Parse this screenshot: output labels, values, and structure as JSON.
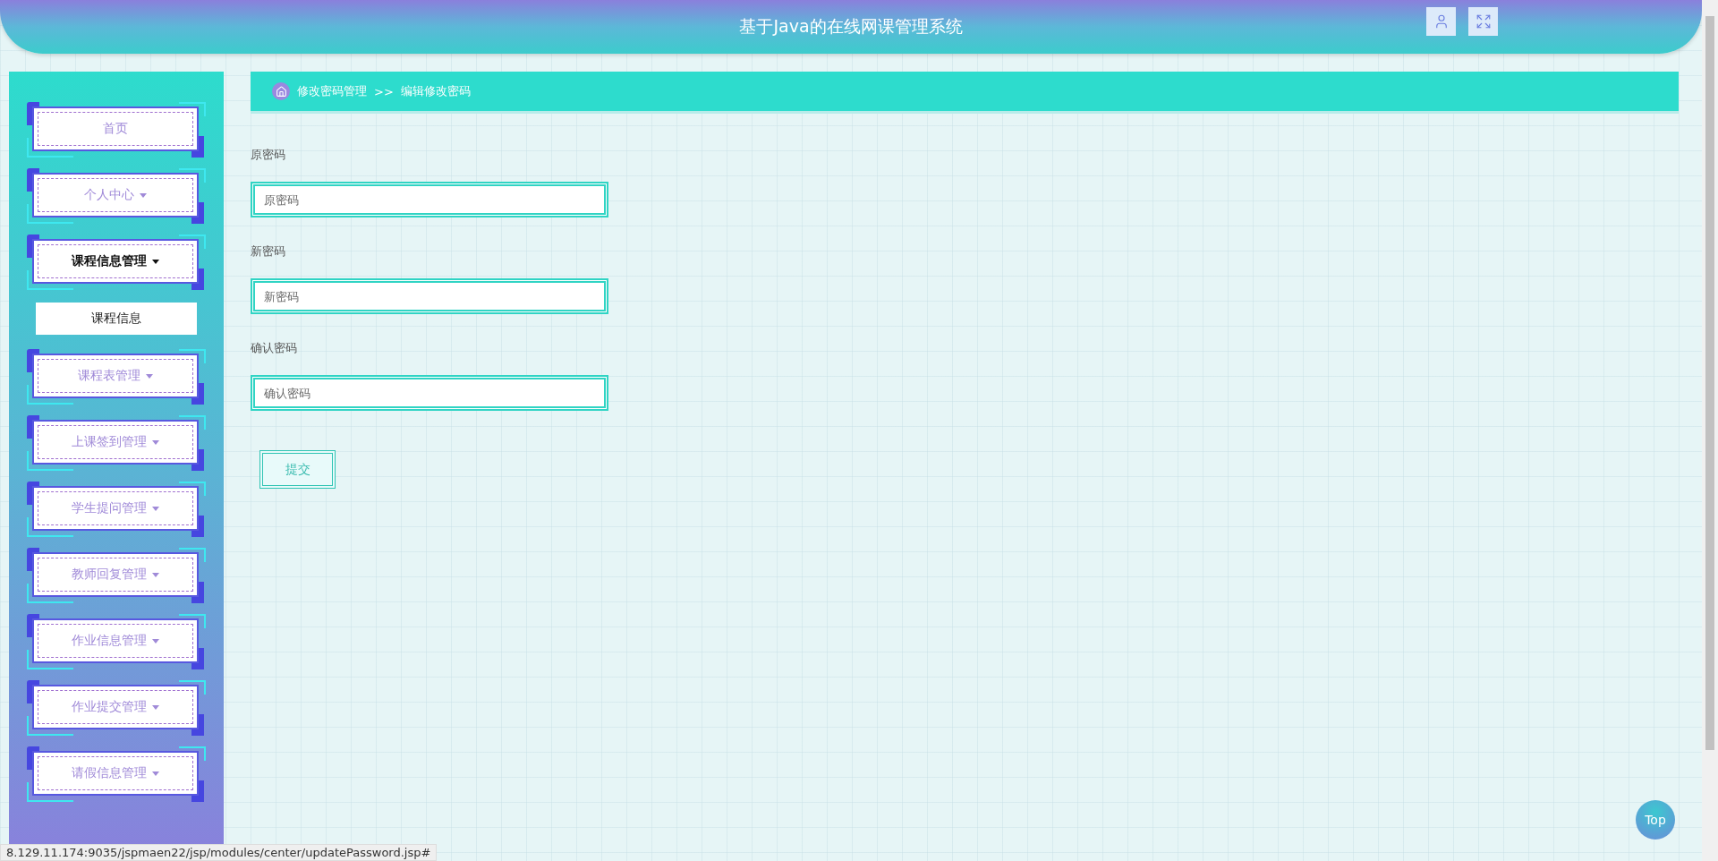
{
  "header": {
    "title": "基于Java的在线网课管理系统"
  },
  "sidebar": {
    "items": [
      {
        "label": "首页",
        "kind": "link",
        "expanded": false
      },
      {
        "label": "个人中心",
        "kind": "dropdown",
        "expanded": false
      },
      {
        "label": "课程信息管理",
        "kind": "dropdown",
        "expanded": true,
        "children": [
          {
            "label": "课程信息"
          }
        ]
      },
      {
        "label": "课程表管理",
        "kind": "dropdown",
        "expanded": false
      },
      {
        "label": "上课签到管理",
        "kind": "dropdown",
        "expanded": false
      },
      {
        "label": "学生提问管理",
        "kind": "dropdown",
        "expanded": false
      },
      {
        "label": "教师回复管理",
        "kind": "dropdown",
        "expanded": false
      },
      {
        "label": "作业信息管理",
        "kind": "dropdown",
        "expanded": false
      },
      {
        "label": "作业提交管理",
        "kind": "dropdown",
        "expanded": false
      },
      {
        "label": "请假信息管理",
        "kind": "dropdown",
        "expanded": false
      }
    ]
  },
  "breadcrumb": {
    "items": [
      "修改密码管理",
      "编辑修改密码"
    ],
    "separator": ">>"
  },
  "form": {
    "fields": [
      {
        "label": "原密码",
        "placeholder": "原密码"
      },
      {
        "label": "新密码",
        "placeholder": "新密码"
      },
      {
        "label": "确认密码",
        "placeholder": "确认密码"
      }
    ],
    "submit": "提交"
  },
  "top_button": "Top",
  "status_url": "8.129.11.174:9035/jspmaen22/jsp/modules/center/updatePassword.jsp#"
}
